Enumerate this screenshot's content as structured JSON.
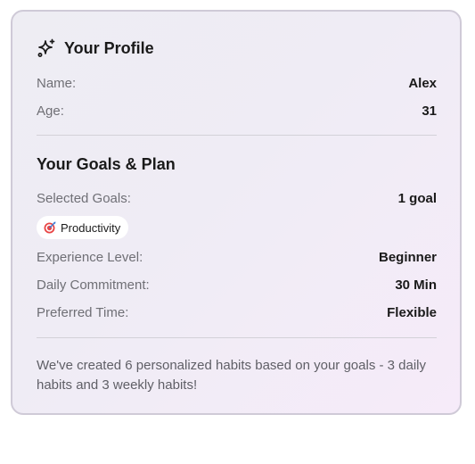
{
  "profile": {
    "title": "Your Profile",
    "icon": "sparkles-icon",
    "name_label": "Name:",
    "name_value": "Alex",
    "age_label": "Age:",
    "age_value": "31"
  },
  "goals": {
    "title": "Your Goals & Plan",
    "selected_goals_label": "Selected Goals:",
    "selected_goals_value": "1 goal",
    "chips": [
      {
        "icon": "target-icon",
        "label": "Productivity"
      }
    ],
    "experience_label": "Experience Level:",
    "experience_value": "Beginner",
    "commitment_label": "Daily Commitment:",
    "commitment_value": "30 Min",
    "preferred_time_label": "Preferred Time:",
    "preferred_time_value": "Flexible"
  },
  "summary": {
    "text": "We've created 6 personalized habits based on your goals - 3 daily habits and 3 weekly habits!"
  },
  "colors": {
    "card_border": "#cfcad7",
    "label": "#6f6f75",
    "value": "#1a1a1a"
  }
}
